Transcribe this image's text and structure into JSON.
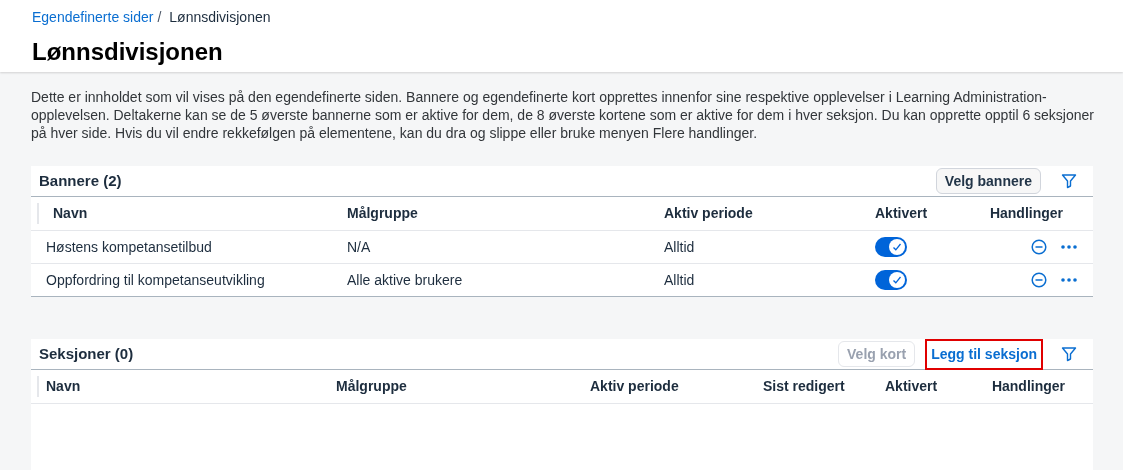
{
  "breadcrumb": [
    {
      "label": "Egendefinerte sider",
      "kind": "link"
    },
    {
      "label": "/",
      "kind": "separator"
    },
    {
      "label": "Lønnsdivisjonen",
      "kind": "current"
    }
  ],
  "page_title": "Lønnsdivisjonen",
  "description": "Dette er innholdet som vil vises på den egendefinerte siden. Bannere og egendefinerte kort opprettes innenfor sine respektive opplevelser i Learning Administration-opplevelsen. Deltakerne kan se de 5 øverste bannerne som er aktive for dem, de 8 øverste kortene som er aktive for dem i hver seksjon. Du kan opprette opptil 6 seksjoner på hver side. Hvis du vil endre rekkefølgen på elementene, kan du dra og slippe eller bruke menyen Flere handlinger.",
  "banners": {
    "title": "Bannere (2)",
    "buttons": [
      {
        "label": "Velg bannere",
        "kind": "outline",
        "disabled": false,
        "highlighted": false
      }
    ],
    "columns": [
      "Navn",
      "Målgruppe",
      "Aktiv periode",
      "Aktivert",
      "Handlinger"
    ],
    "rows": [
      {
        "name": "Høstens kompetansetilbud",
        "audience": "N/A",
        "period": "Alltid",
        "active": true
      },
      {
        "name": "Oppfordring til kompetanseutvikling",
        "audience": "Alle aktive brukere",
        "period": "Alltid",
        "active": true
      }
    ]
  },
  "sections": {
    "title": "Seksjoner (0)",
    "buttons": [
      {
        "label": "Velg kort",
        "kind": "outline",
        "disabled": true,
        "highlighted": false
      },
      {
        "label": "Legg til seksjon",
        "kind": "link",
        "disabled": false,
        "highlighted": true
      }
    ],
    "columns": [
      "Navn",
      "Målgruppe",
      "Aktiv periode",
      "Sist redigert",
      "Aktivert",
      "Handlinger"
    ]
  }
}
